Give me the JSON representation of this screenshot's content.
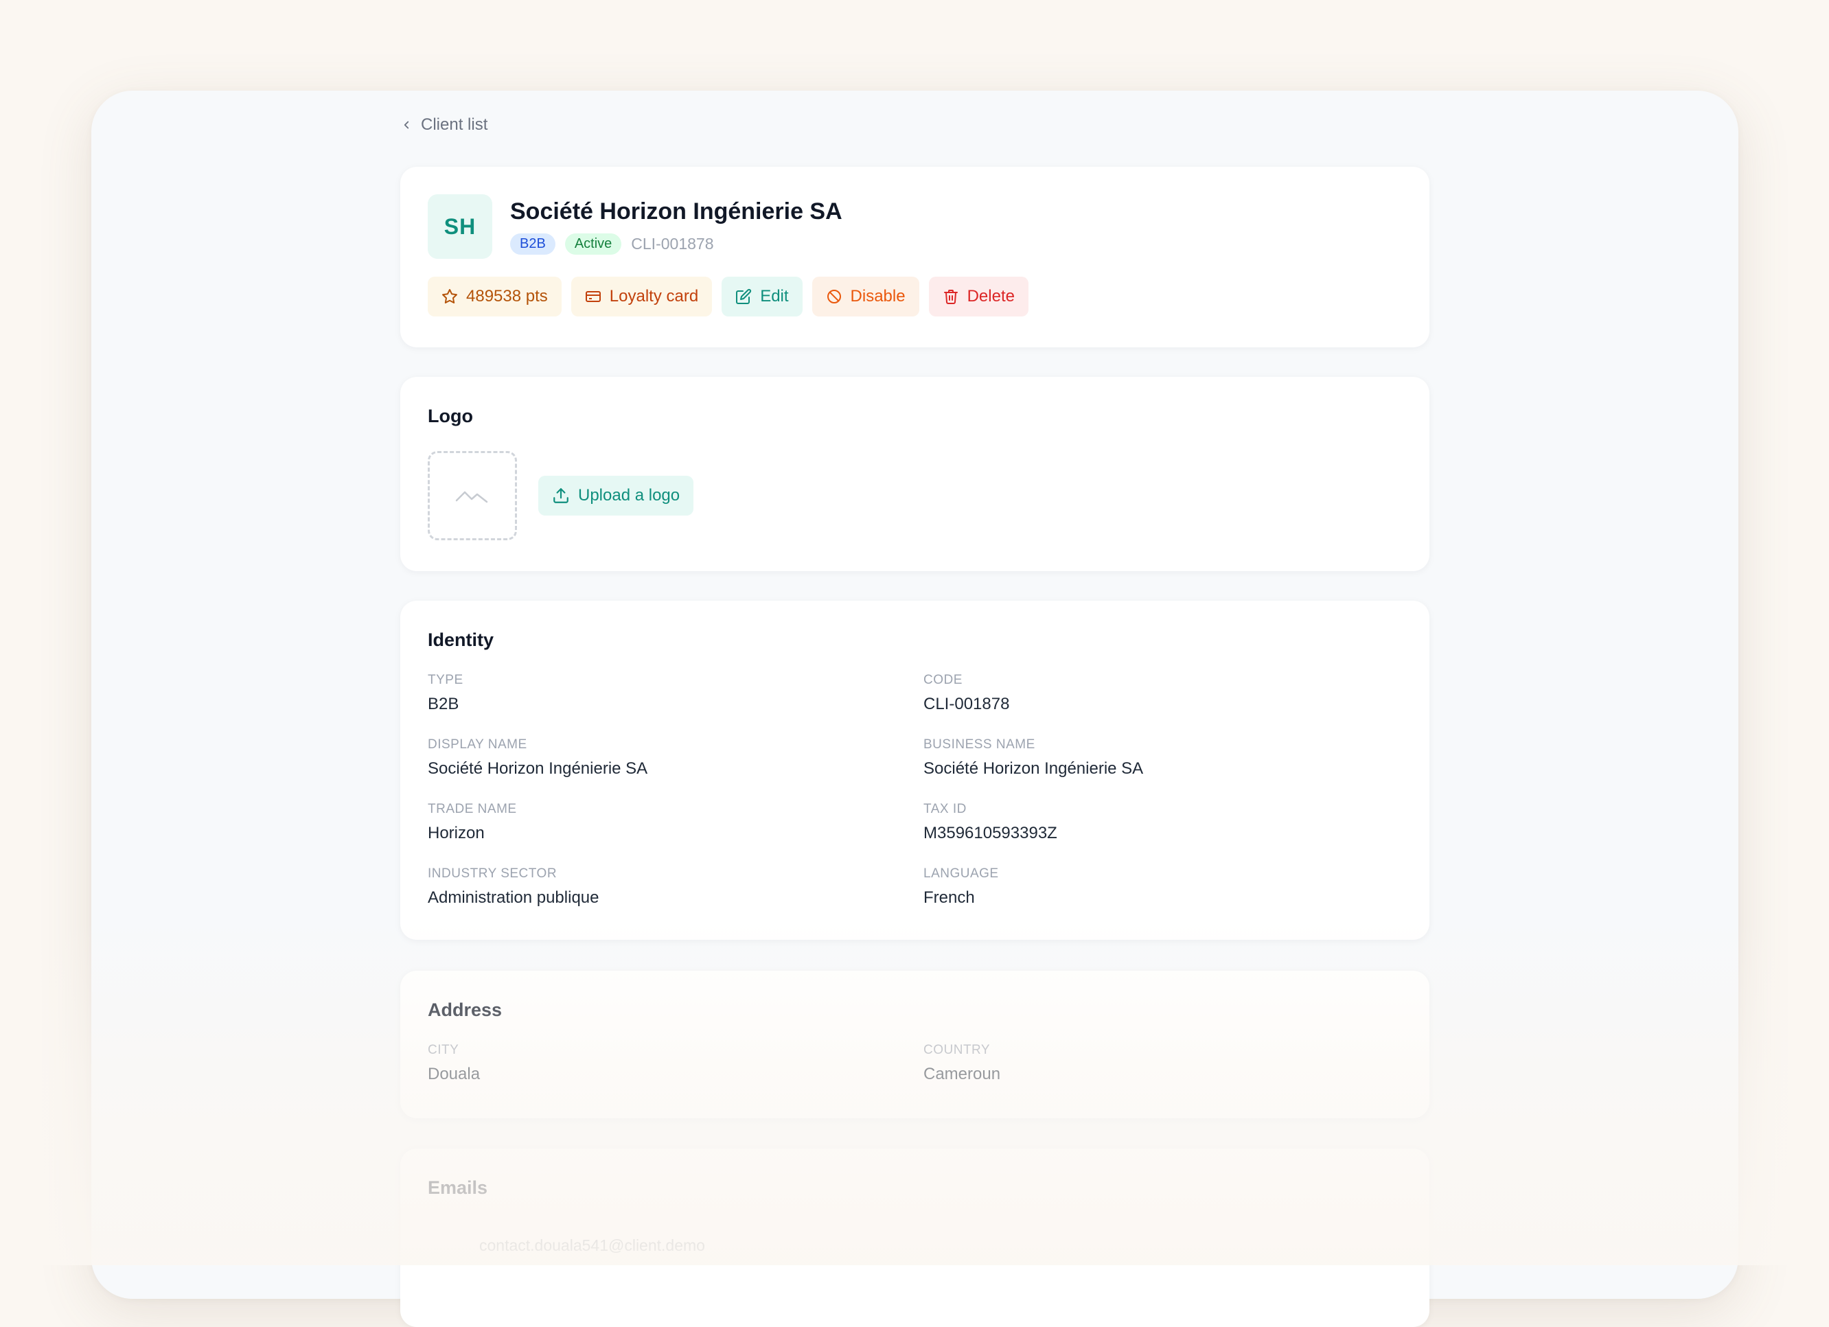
{
  "nav": {
    "back_label": "Client list"
  },
  "client": {
    "initials": "SH",
    "name": "Société Horizon Ingénierie SA",
    "type_badge": "B2B",
    "status_badge": "Active",
    "code": "CLI-001878"
  },
  "actions": {
    "points_label": "489538 pts",
    "loyalty_label": "Loyalty card",
    "edit_label": "Edit",
    "disable_label": "Disable",
    "delete_label": "Delete"
  },
  "logo_section": {
    "title": "Logo",
    "upload_label": "Upload a logo"
  },
  "identity": {
    "title": "Identity",
    "fields": [
      {
        "label": "Type",
        "value": "B2B"
      },
      {
        "label": "Code",
        "value": "CLI-001878"
      },
      {
        "label": "Display name",
        "value": "Société Horizon Ingénierie SA"
      },
      {
        "label": "Business name",
        "value": "Société Horizon Ingénierie SA"
      },
      {
        "label": "Trade name",
        "value": "Horizon"
      },
      {
        "label": "Tax ID",
        "value": "M359610593393Z"
      },
      {
        "label": "Industry sector",
        "value": "Administration publique"
      },
      {
        "label": "Language",
        "value": "French"
      }
    ]
  },
  "address": {
    "title": "Address",
    "fields": [
      {
        "label": "City",
        "value": "Douala"
      },
      {
        "label": "Country",
        "value": "Cameroun"
      }
    ]
  },
  "emails": {
    "title": "Emails",
    "items": [
      {
        "address": "contact.douala541@client.demo"
      }
    ]
  },
  "colors": {
    "accent": "#0f8f7d",
    "danger": "#dc2626",
    "warning": "#ea580c",
    "points": "#b45309"
  }
}
